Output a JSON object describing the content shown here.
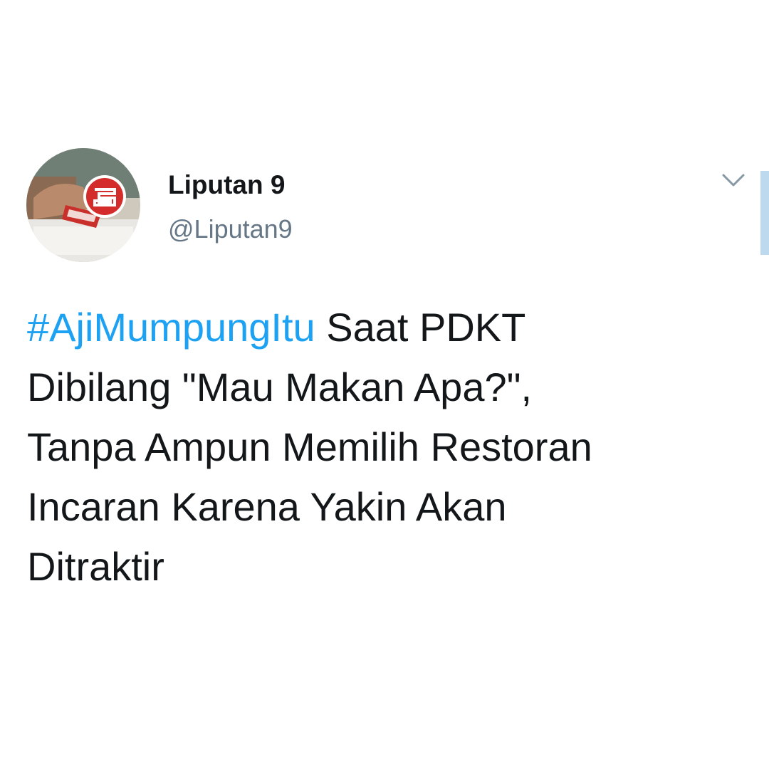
{
  "tweet": {
    "author": {
      "display_name": "Liputan 9",
      "handle": "@Liputan9",
      "avatar_icon": "liputan9-logo-avatar"
    },
    "menu_icon": "chevron-down-icon",
    "hashtag": "#AjiMumpungItu",
    "text_lines": [
      " Saat PDKT",
      "Dibilang \"Mau Makan Apa?\",",
      "Tanpa Ampun Memilih Restoran",
      "Incaran Karena Yakin Akan",
      "Ditraktir"
    ]
  },
  "colors": {
    "text": "#14171a",
    "secondary_text": "#657786",
    "link": "#1da1f2",
    "scroll_indicator": "#bcd9ee",
    "background": "#ffffff"
  }
}
